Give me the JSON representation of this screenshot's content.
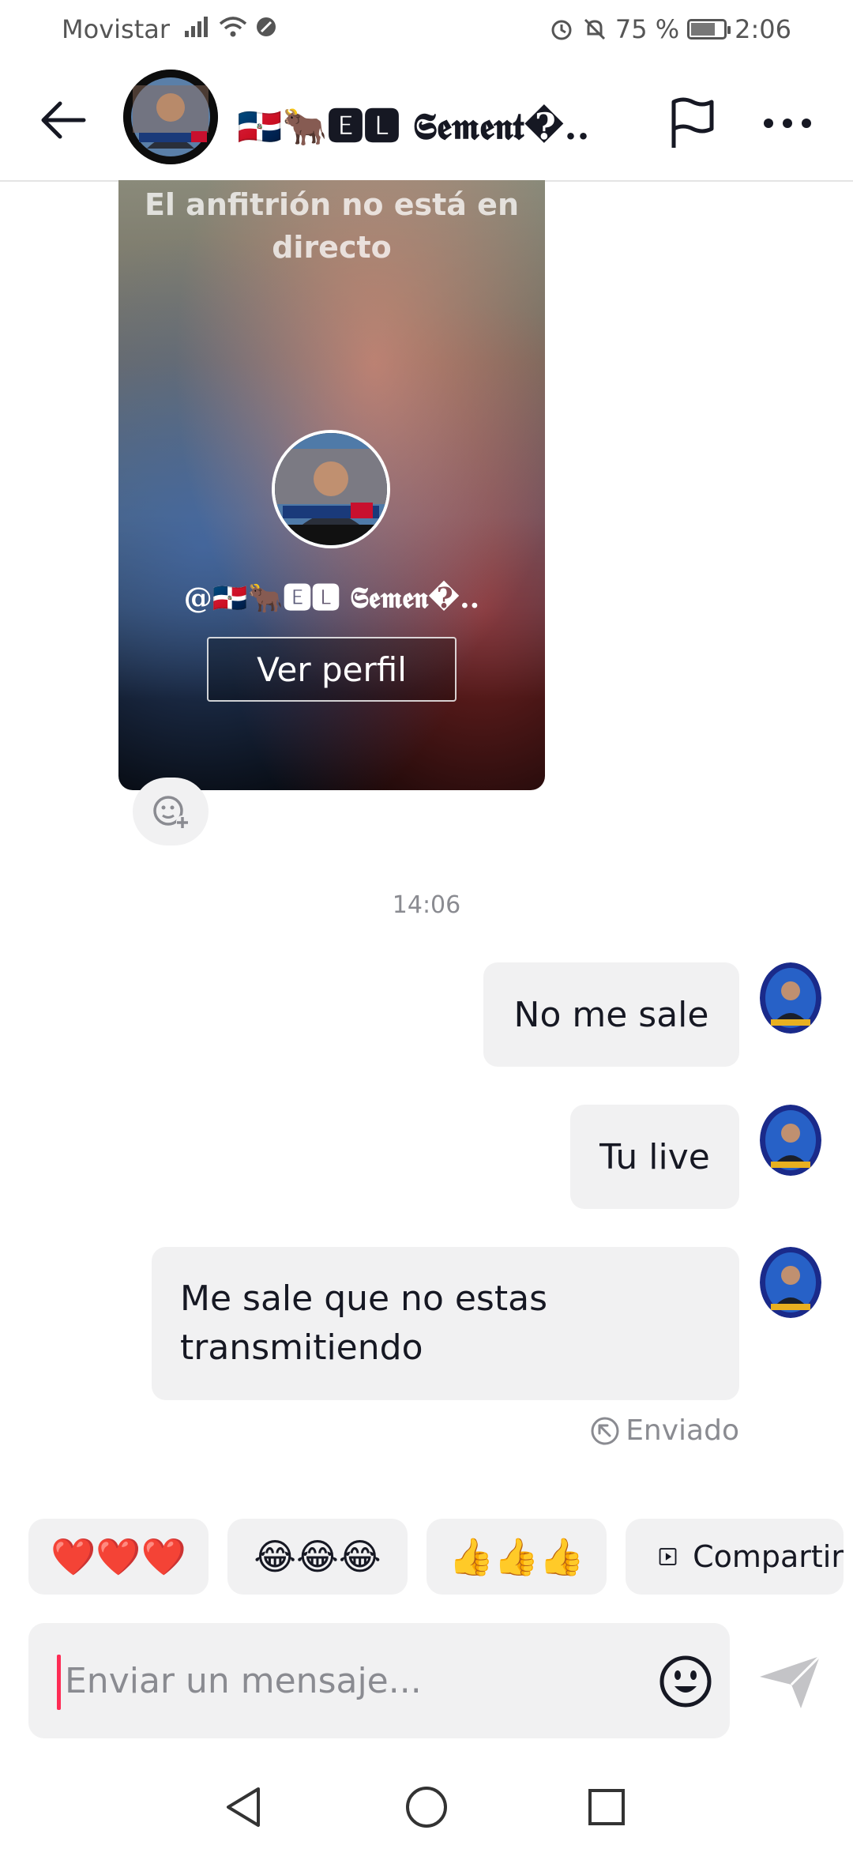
{
  "status_bar": {
    "carrier": "Movistar",
    "battery_percent": "75 %",
    "battery_level": 0.75,
    "time": "2:06"
  },
  "header": {
    "contact_name": "🇩🇴🐂🅴🅻 𝕾𝖊𝖒𝖊𝖓𝖙�.."
  },
  "live_card": {
    "status_text": "El anfitrión no está en directo",
    "handle": "@🇩🇴🐂🅴🅻 𝕾𝖊𝖒𝖊𝖓�..",
    "view_profile_label": "Ver perfil"
  },
  "conversation": {
    "timestamp": "14:06",
    "messages": [
      {
        "text": "No me sale"
      },
      {
        "text": "Tu live"
      },
      {
        "text": "Me sale que no estas transmitiendo"
      }
    ],
    "sent_status": "Enviado"
  },
  "quick_replies": [
    {
      "label": "❤️❤️❤️"
    },
    {
      "label": "😂😂😂"
    },
    {
      "label": "👍👍👍"
    },
    {
      "label": "Compartir"
    }
  ],
  "input": {
    "placeholder": "Enviar un mensaje..."
  },
  "colors": {
    "accent": "#fe2c55",
    "bubble": "#f1f1f2",
    "muted_text": "#8a8b91"
  }
}
